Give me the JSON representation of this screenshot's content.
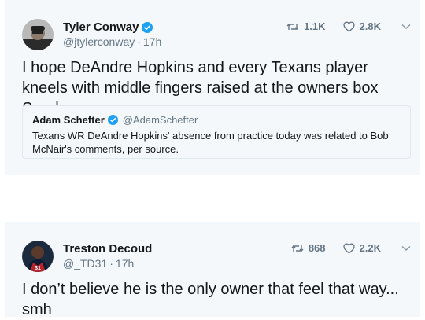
{
  "tweets": [
    {
      "display_name": "Tyler Conway",
      "verified": true,
      "handle": "@jtylerconway",
      "time": "17h",
      "retweets": "1.1K",
      "likes": "2.8K",
      "text": "I hope DeAndre Hopkins and every Texans player kneels with middle fingers raised at the owners box Sunday",
      "quote": {
        "display_name": "Adam Schefter",
        "verified": true,
        "handle": "@AdamSchefter",
        "text": "Texans WR DeAndre Hopkins' absence from practice today was related to Bob McNair's comments, per source."
      }
    },
    {
      "display_name": "Treston Decoud",
      "verified": false,
      "handle": "@_TD31",
      "time": "17h",
      "retweets": "868",
      "likes": "2.2K",
      "text": "I don’t believe he is the only owner that feel that way... smh"
    }
  ],
  "colors": {
    "card_bg": "#f5f8fa",
    "text": "#14171a",
    "secondary": "#657786",
    "verified": "#1da1f2",
    "border": "#e1e8ed"
  },
  "icons": [
    "retweet-icon",
    "heart-icon",
    "chevron-down-icon",
    "verified-badge-icon"
  ]
}
